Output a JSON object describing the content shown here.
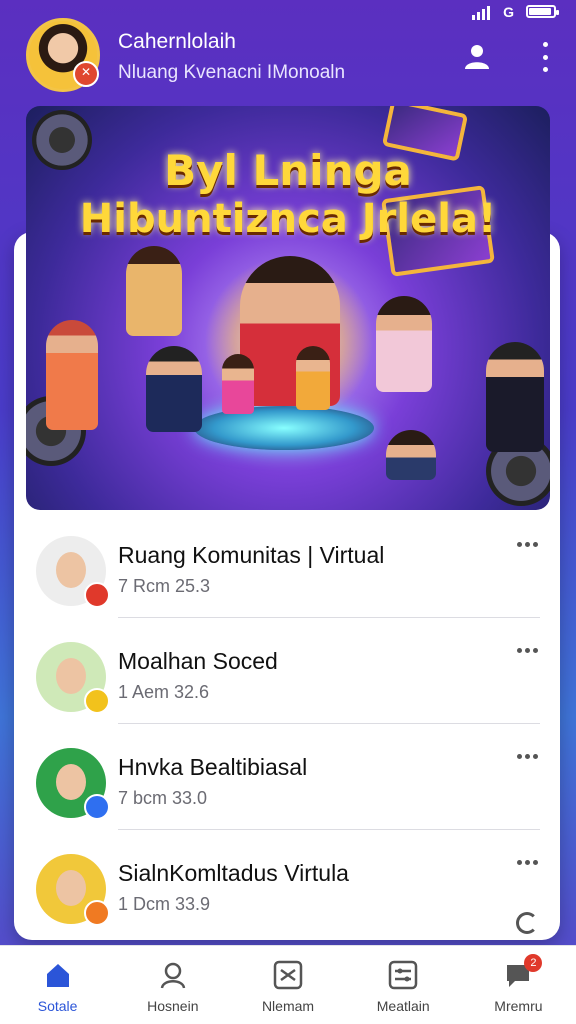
{
  "status_bar": {
    "network": "G"
  },
  "header": {
    "name": "Cahernlolaih",
    "subtitle": "Nluang Kvenacni IMonoaln"
  },
  "banner": {
    "title_line1": "Byl Lninga",
    "title_line2": "Hibuntiznca Jrlela!"
  },
  "rooms": [
    {
      "title": "Ruang Komunitas  |  Virtual",
      "meta": "7  Rcm 25.3",
      "avatar_bg": "#ededed",
      "badge_color": "#e0392b"
    },
    {
      "title": "Moalhan Soced",
      "meta": "1  Aem 32.6",
      "avatar_bg": "#cfe9b8",
      "badge_color": "#f2c21c"
    },
    {
      "title": "Hnvka Bealtibiasal",
      "meta": "7  bcm 33.0",
      "avatar_bg": "#2fa24a",
      "badge_color": "#2f6ff0"
    },
    {
      "title": "SialnKomltadus Virtula",
      "meta": "1  Dcm 33.9",
      "avatar_bg": "#f1c83a",
      "badge_color": "#f07a22"
    }
  ],
  "nav": {
    "items": [
      {
        "label": "Sotale",
        "icon": "home-icon"
      },
      {
        "label": "Hosnein",
        "icon": "person-icon"
      },
      {
        "label": "Nlemam",
        "icon": "shuffle-icon"
      },
      {
        "label": "Meatlain",
        "icon": "settings-icon"
      },
      {
        "label": "Mremru",
        "icon": "message-icon"
      }
    ],
    "notification_count": "2"
  },
  "colors": {
    "accent": "#2b55d8",
    "header_bg": "#5b2fc0"
  }
}
